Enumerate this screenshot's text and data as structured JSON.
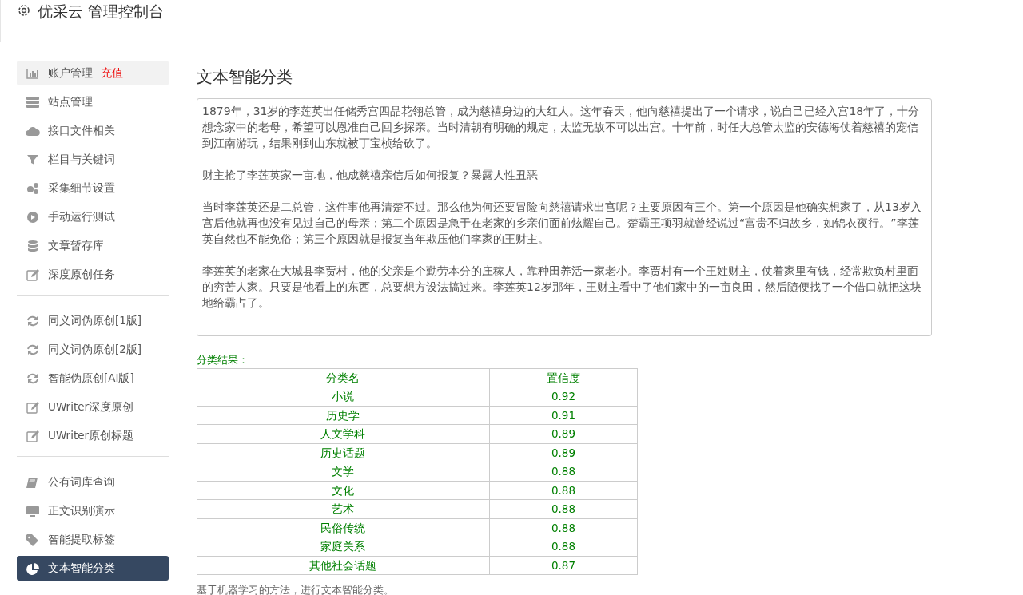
{
  "header": {
    "title": "优采云 管理控制台"
  },
  "sidebar": {
    "groups": [
      {
        "items": [
          {
            "label": "账户管理",
            "badge": "充值",
            "selected": false,
            "hover": true
          },
          {
            "label": "站点管理",
            "selected": false,
            "hover": false
          },
          {
            "label": "接口文件相关",
            "selected": false,
            "hover": false
          },
          {
            "label": "栏目与关键词",
            "selected": false,
            "hover": false
          },
          {
            "label": "采集细节设置",
            "selected": false,
            "hover": false
          },
          {
            "label": "手动运行测试",
            "selected": false,
            "hover": false
          },
          {
            "label": "文章暂存库",
            "selected": false,
            "hover": false
          },
          {
            "label": "深度原创任务",
            "selected": false,
            "hover": false
          }
        ]
      },
      {
        "items": [
          {
            "label": "同义词伪原创[1版]",
            "selected": false,
            "hover": false
          },
          {
            "label": "同义词伪原创[2版]",
            "selected": false,
            "hover": false
          },
          {
            "label": "智能伪原创[AI版]",
            "selected": false,
            "hover": false
          },
          {
            "label": "UWriter深度原创",
            "selected": false,
            "hover": false
          },
          {
            "label": "UWriter原创标题",
            "selected": false,
            "hover": false
          }
        ]
      },
      {
        "items": [
          {
            "label": "公有词库查询",
            "selected": false,
            "hover": false
          },
          {
            "label": "正文识别演示",
            "selected": false,
            "hover": false
          },
          {
            "label": "智能提取标签",
            "selected": false,
            "hover": false
          },
          {
            "label": "文本智能分类",
            "selected": true,
            "hover": false
          }
        ]
      }
    ]
  },
  "main": {
    "title": "文本智能分类",
    "article": {
      "paragraphs": [
        "1879年，31岁的李莲英出任储秀宫四品花翎总管，成为慈禧身边的大红人。这年春天，他向慈禧提出了一个请求，说自己已经入宫18年了，十分想念家中的老母，希望可以恩准自己回乡探亲。当时清朝有明确的规定，太监无故不可以出宫。十年前，时任大总管太监的安德海仗着慈禧的宠信到江南游玩，结果刚到山东就被丁宝桢给砍了。",
        "财主抢了李莲英家一亩地，他成慈禧亲信后如何报复？暴露人性丑恶",
        "当时李莲英还是二总管，这件事他再清楚不过。那么他为何还要冒险向慈禧请求出宫呢？主要原因有三个。第一个原因是他确实想家了，从13岁入宫后他就再也没有见过自己的母亲；第二个原因是急于在老家的乡亲们面前炫耀自己。楚霸王项羽就曾经说过“富贵不归故乡，如锦衣夜行。”李莲英自然也不能免俗；第三个原因就是报复当年欺压他们李家的王财主。",
        "李莲英的老家在大城县李贾村，他的父亲是个勤劳本分的庄稼人，靠种田养活一家老小。李贾村有一个王姓财主，仗着家里有钱，经常欺负村里面的穷苦人家。只要是他看上的东西，总要想方设法搞过来。李莲英12岁那年，王财主看中了他们家中的一亩良田，然后随便找了一个借口就把这块地给霸占了。"
      ]
    },
    "result_label": "分类结果：",
    "table": {
      "columns": [
        "分类名",
        "置信度"
      ],
      "rows": [
        [
          "小说",
          "0.92"
        ],
        [
          "历史学",
          "0.91"
        ],
        [
          "人文学科",
          "0.89"
        ],
        [
          "历史话题",
          "0.89"
        ],
        [
          "文学",
          "0.88"
        ],
        [
          "文化",
          "0.88"
        ],
        [
          "艺术",
          "0.88"
        ],
        [
          "民俗传统",
          "0.88"
        ],
        [
          "家庭关系",
          "0.88"
        ],
        [
          "其他社会话题",
          "0.87"
        ]
      ]
    },
    "footnote": "基于机器学习的方法，进行文本智能分类。"
  }
}
